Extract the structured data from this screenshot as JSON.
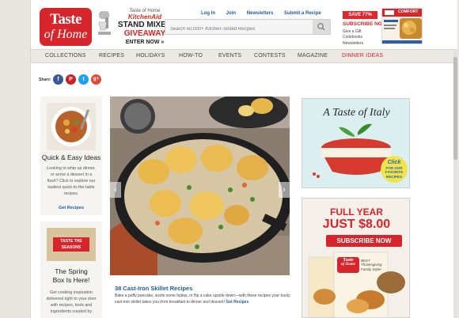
{
  "header": {
    "logo_line1": "Taste",
    "logo_line2": "of Home",
    "promo_brand": "KitchenAid",
    "promo_small": "Taste of Home",
    "promo_line1": "STAND MIXER",
    "promo_line2": "GIVEAWAY",
    "promo_cta": "ENTER NOW »",
    "top_links": [
      "Log In",
      "Join",
      "Newsletters",
      "Submit a Recipe"
    ],
    "search_placeholder": "Search 50,000+ Kitchen-Tested Recipes",
    "save_badge": "SAVE 77%",
    "subscribe_label": "SUBSCRIBE NOW",
    "sub_links": [
      "Give a Gift",
      "Cookbooks",
      "Newsletters"
    ],
    "magazine_word": "COMFORT"
  },
  "nav": {
    "items": [
      "COLLECTIONS",
      "RECIPES",
      "HOLIDAYS",
      "HOW-TO",
      "EVENTS",
      "CONTESTS",
      "MAGAZINE",
      "DINNER IDEAS"
    ]
  },
  "share": {
    "label": "Share:",
    "icons": [
      {
        "name": "facebook-icon",
        "glyph": "f",
        "color": "#3b5998"
      },
      {
        "name": "pinterest-icon",
        "glyph": "P",
        "color": "#cb2027"
      },
      {
        "name": "twitter-icon",
        "glyph": "t",
        "color": "#1da1f2"
      },
      {
        "name": "google-plus-icon",
        "glyph": "g+",
        "color": "#dd4b39"
      }
    ]
  },
  "sidebar": {
    "cards": [
      {
        "title": "Quick & Easy Ideas",
        "desc": "Looking to whip up dinner, or serve a dessert in a flash? Click to explore our tastiest quick-to-the-table recipes.",
        "link": "Get Recipes"
      },
      {
        "badge1": "TASTE THE",
        "badge2": "SEASONS",
        "title": "The Spring Box Is Here!",
        "desc": "Get cooking inspiration delivered right to your door with recipes, tools and ingredients curated by"
      }
    ]
  },
  "carousel": {
    "total_slides": 6,
    "active_slide": 5,
    "title": "38 Cast-Iron Skillet Recipes",
    "desc": "Bake a puffy pancake, sizzle some fajitas, or flip a cake upside down—with these recipes your trusty cast-iron skillet takes you from breakfast to dinner and dessert!",
    "link": "Get Recipes"
  },
  "ads": {
    "italy_title": "A Taste of Italy",
    "italy_cta1": "Click",
    "italy_cta2": "FOR OUR",
    "italy_cta3": "FAVORITE",
    "italy_cta4": "RECIPES",
    "sub_line1": "FULL YEAR",
    "sub_line2": "JUST $8.00",
    "sub_button": "SUBSCRIBE NOW",
    "mag_logo1": "Taste",
    "mag_logo2": "of Home",
    "mag_tag": "BEST Thanksgiving Family Style!"
  },
  "colors": {
    "brand_red": "#d6262b",
    "link_blue": "#1f5b9c",
    "nav_bg": "#ece8e4"
  }
}
